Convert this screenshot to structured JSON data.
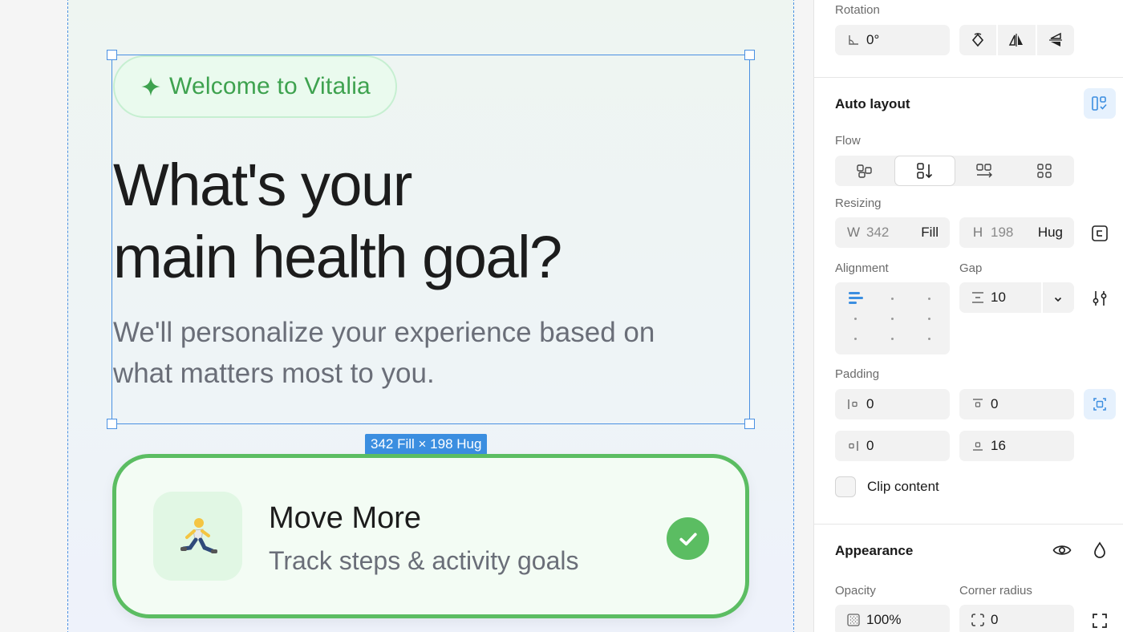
{
  "canvas": {
    "badge_text": "Welcome to Vitalia",
    "headline_lines": [
      "What's your",
      "main health goal?"
    ],
    "subtext_lines": [
      "We'll personalize your experience based on",
      "what matters most to you."
    ],
    "selection_size_label": "342 Fill × 198 Hug",
    "option_card": {
      "emoji": "🏃",
      "title": "Move More",
      "description": "Track steps & activity goals",
      "selected": true
    },
    "colors": {
      "accent_green": "#5bbd62",
      "badge_text_green": "#3ea24f",
      "selection_blue": "#4a90e2"
    }
  },
  "panel": {
    "rotation": {
      "label": "Rotation",
      "value": "0°",
      "actions": [
        "rotate-icon",
        "flip-horizontal-icon",
        "flip-vertical-icon"
      ]
    },
    "auto_layout": {
      "title": "Auto layout",
      "flow": {
        "label": "Flow",
        "options": [
          "freeform-icon",
          "vertical-icon",
          "horizontal-icon",
          "grid-icon"
        ],
        "active_index": 1
      },
      "resizing": {
        "label": "Resizing",
        "width": {
          "prefix": "W",
          "value": "342",
          "mode": "Fill"
        },
        "height": {
          "prefix": "H",
          "value": "198",
          "mode": "Hug"
        }
      },
      "alignment": {
        "label": "Alignment",
        "active": "top-left"
      },
      "gap": {
        "label": "Gap",
        "value": "10"
      },
      "padding": {
        "label": "Padding",
        "left": "0",
        "top": "0",
        "right": "0",
        "bottom": "16"
      },
      "clip_content": {
        "label": "Clip content",
        "checked": false
      }
    },
    "appearance": {
      "title": "Appearance",
      "opacity": {
        "label": "Opacity",
        "value": "100%"
      },
      "corner_radius": {
        "label": "Corner radius",
        "value": "0"
      }
    }
  }
}
